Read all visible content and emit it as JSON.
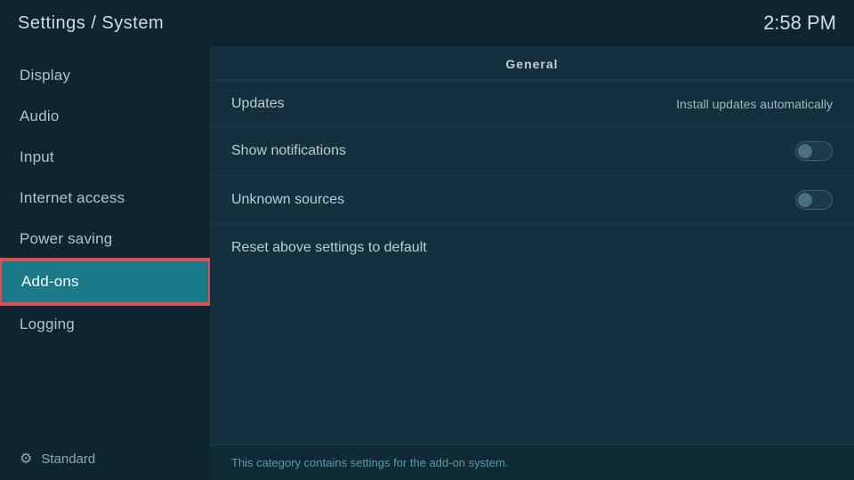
{
  "header": {
    "title": "Settings / System",
    "time": "2:58 PM"
  },
  "sidebar": {
    "items": [
      {
        "id": "display",
        "label": "Display"
      },
      {
        "id": "audio",
        "label": "Audio"
      },
      {
        "id": "input",
        "label": "Input"
      },
      {
        "id": "internet-access",
        "label": "Internet access"
      },
      {
        "id": "power-saving",
        "label": "Power saving"
      },
      {
        "id": "add-ons",
        "label": "Add-ons",
        "active": true
      },
      {
        "id": "logging",
        "label": "Logging"
      }
    ],
    "footer": {
      "icon": "gear",
      "label": "Standard"
    }
  },
  "content": {
    "section": "General",
    "settings": [
      {
        "id": "updates",
        "label": "Updates",
        "value": "Install updates automatically",
        "type": "value"
      },
      {
        "id": "show-notifications",
        "label": "Show notifications",
        "type": "toggle",
        "enabled": false
      },
      {
        "id": "unknown-sources",
        "label": "Unknown sources",
        "type": "toggle",
        "enabled": false
      },
      {
        "id": "reset",
        "label": "Reset above settings to default",
        "type": "action"
      }
    ],
    "footer_text": "This category contains settings for the add-on system."
  }
}
